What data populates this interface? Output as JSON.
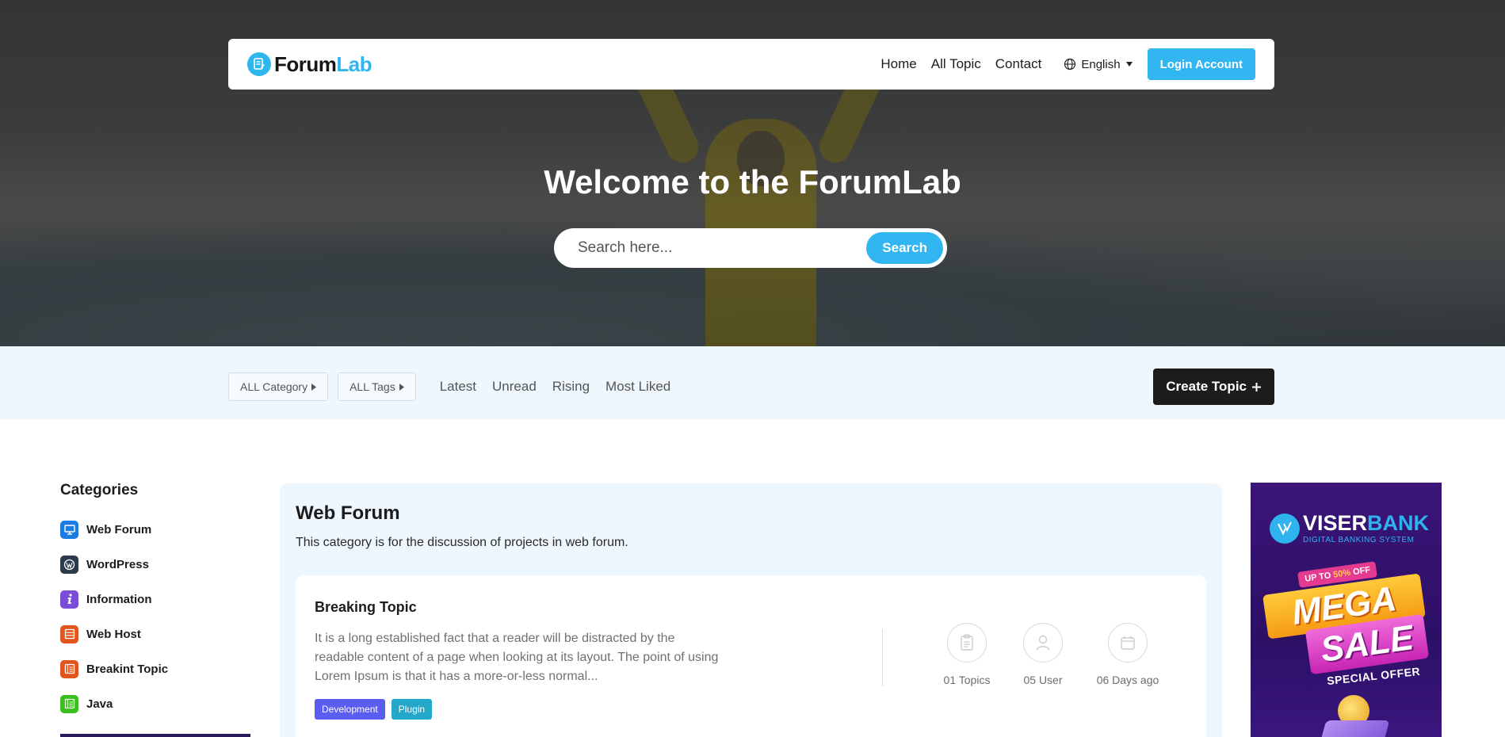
{
  "brand": {
    "name_part1": "Forum",
    "name_part2": "Lab"
  },
  "nav": {
    "links": [
      "Home",
      "All Topic",
      "Contact"
    ],
    "language": "English",
    "login_label": "Login Account"
  },
  "hero": {
    "title": "Welcome to the ForumLab",
    "search_placeholder": "Search here...",
    "search_button": "Search"
  },
  "filters": {
    "category_label": "ALL Category",
    "tags_label": "ALL Tags",
    "tabs": [
      "Latest",
      "Unread",
      "Rising",
      "Most Liked"
    ],
    "create_label": "Create Topic"
  },
  "sidebar": {
    "title": "Categories",
    "items": [
      {
        "label": "Web Forum",
        "icon": "monitor-icon",
        "color": "#1a7be3"
      },
      {
        "label": "WordPress",
        "icon": "wordpress-icon",
        "color": "#2c3a4d"
      },
      {
        "label": "Information",
        "icon": "info-icon",
        "color": "#7b4cd6"
      },
      {
        "label": "Web Host",
        "icon": "server-icon",
        "color": "#e0561d"
      },
      {
        "label": "Breakint Topic",
        "icon": "list-icon",
        "color": "#e0561d"
      },
      {
        "label": "Java",
        "icon": "list-icon",
        "color": "#3ac01d"
      }
    ]
  },
  "main": {
    "title": "Web Forum",
    "description": "This category is for the discussion of projects in web forum.",
    "topic": {
      "title": "Breaking Topic",
      "text": "It is a long established fact that a reader will be distracted by the readable content of a page when looking at its layout. The point of using Lorem Ipsum is that it has a more-or-less normal...",
      "tags": [
        {
          "label": "Development",
          "color": "#5b5cf0"
        },
        {
          "label": "Plugin",
          "color": "#24a8c9"
        }
      ],
      "stats": {
        "topics": "01 Topics",
        "users": "05 User",
        "age": "06 Days ago"
      }
    }
  },
  "ad": {
    "brand_part1": "VISER",
    "brand_part2": "BANK",
    "subtitle": "DIGITAL BANKING SYSTEM",
    "offer_prefix": "UP TO ",
    "offer_percent": "50%",
    "offer_suffix": " OFF",
    "headline1": "MEGA",
    "headline2": "SALE",
    "tagline": "SPECIAL OFFER"
  },
  "colors": {
    "accent": "#31b6f2",
    "dark": "#1c1c1c",
    "filter_bg": "#eef7fd"
  }
}
